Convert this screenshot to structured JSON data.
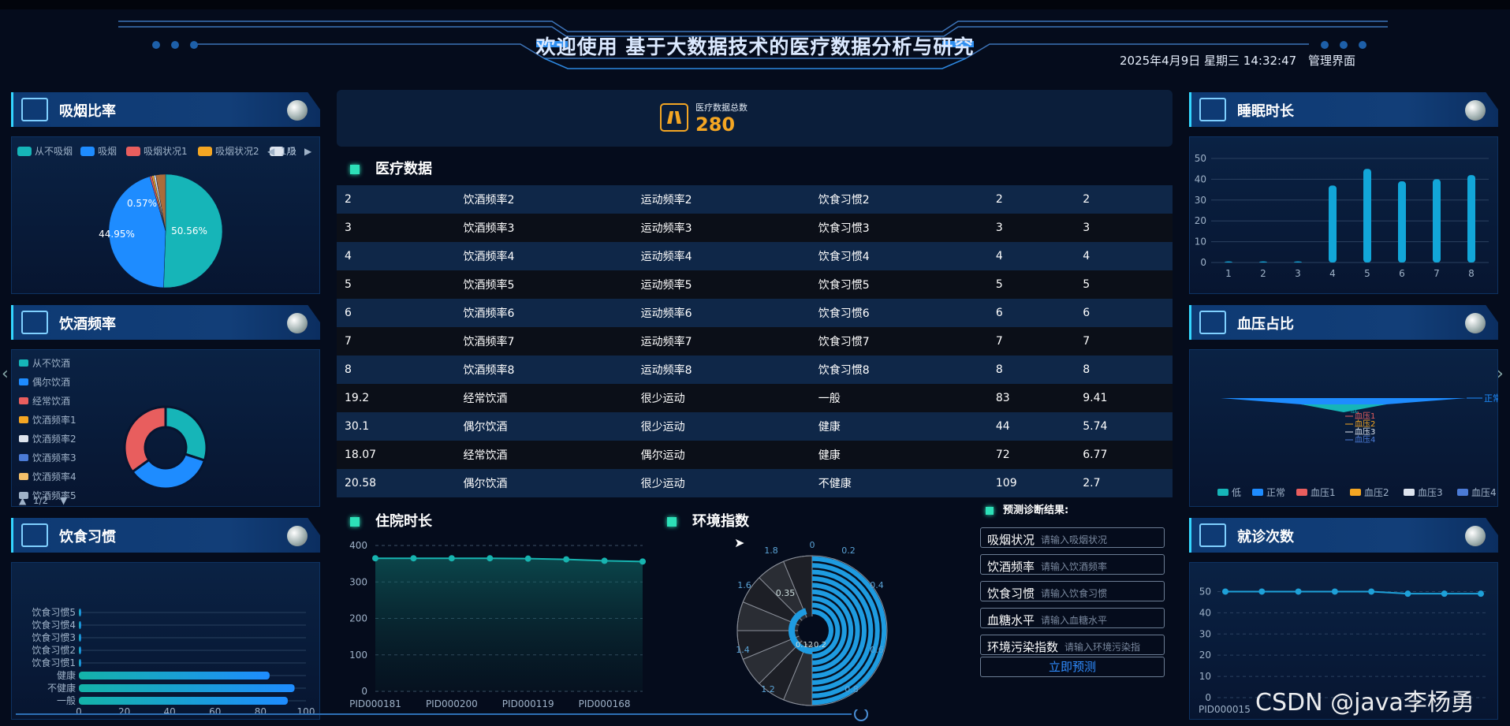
{
  "header": {
    "title": "欢迎使用 基于大数据技术的医疗数据分析与研究",
    "datetime": "2025年4月9日 星期三 14:32:47",
    "admin": "管理界面"
  },
  "panels": {
    "smoke": "吸烟比率",
    "drink": "饮酒频率",
    "diet": "饮食习惯",
    "sleep": "睡眠时长",
    "bp": "血压占比",
    "visits": "就诊次数"
  },
  "total": {
    "label": "医疗数据总数",
    "value": "280"
  },
  "sections": {
    "table": "医疗数据",
    "hospital": "住院时长",
    "env": "环境指数",
    "predict": "预测诊断结果:"
  },
  "table_rows": [
    [
      "2",
      "饮酒频率2",
      "运动频率2",
      "饮食习惯2",
      "2",
      "2"
    ],
    [
      "3",
      "饮酒频率3",
      "运动频率3",
      "饮食习惯3",
      "3",
      "3"
    ],
    [
      "4",
      "饮酒频率4",
      "运动频率4",
      "饮食习惯4",
      "4",
      "4"
    ],
    [
      "5",
      "饮酒频率5",
      "运动频率5",
      "饮食习惯5",
      "5",
      "5"
    ],
    [
      "6",
      "饮酒频率6",
      "运动频率6",
      "饮食习惯6",
      "6",
      "6"
    ],
    [
      "7",
      "饮酒频率7",
      "运动频率7",
      "饮食习惯7",
      "7",
      "7"
    ],
    [
      "8",
      "饮酒频率8",
      "运动频率8",
      "饮食习惯8",
      "8",
      "8"
    ],
    [
      "19.2",
      "经常饮酒",
      "很少运动",
      "一般",
      "83",
      "9.41"
    ],
    [
      "30.1",
      "偶尔饮酒",
      "很少运动",
      "健康",
      "44",
      "5.74"
    ],
    [
      "18.07",
      "经常饮酒",
      "偶尔运动",
      "健康",
      "72",
      "6.77"
    ],
    [
      "20.58",
      "偶尔饮酒",
      "很少运动",
      "不健康",
      "109",
      "2.7"
    ]
  ],
  "predict_form": [
    {
      "label": "吸烟状况",
      "placeholder": "请输入吸烟状况"
    },
    {
      "label": "饮酒频率",
      "placeholder": "请输入饮酒频率"
    },
    {
      "label": "饮食习惯",
      "placeholder": "请输入饮食习惯"
    },
    {
      "label": "血糖水平",
      "placeholder": "请输入血糖水平"
    },
    {
      "label": "环境污染指数",
      "placeholder": "请输入环境污染指"
    }
  ],
  "predict_button": "立即预测",
  "watermark": "CSDN @java李杨勇",
  "colors": {
    "teal": "#16b5b8",
    "blue": "#1e8cff",
    "red": "#e85e5e",
    "orange": "#f4a623",
    "accent": "#34d6ff"
  },
  "chart_data": [
    {
      "type": "pie",
      "panel": "吸烟比率",
      "legend": [
        "从不吸烟",
        "吸烟",
        "吸烟状况1",
        "吸烟状况2",
        "吸"
      ],
      "legend_page": "1/3",
      "values": [
        50.56,
        44.95,
        0.57,
        0.57,
        0.57,
        2.78
      ],
      "data_labels": [
        "50.56%",
        "44.95%",
        "0.57%"
      ],
      "colors": [
        "#16b5b8",
        "#1e8cff",
        "#e85e5e",
        "#f4a623",
        "#dde4ee",
        "#aa6c3a"
      ]
    },
    {
      "type": "pie",
      "panel": "饮酒频率",
      "legend": [
        "从不饮酒",
        "偶尔饮酒",
        "经常饮酒",
        "饮酒频率1",
        "饮酒频率2",
        "饮酒频率3",
        "饮酒频率4",
        "饮酒频率5"
      ],
      "legend_page": "1/2",
      "values": [
        30,
        35,
        35
      ],
      "colors": [
        "#16b5b8",
        "#1e8cff",
        "#e85e5e"
      ]
    },
    {
      "type": "bar",
      "panel": "饮食习惯",
      "categories": [
        "一般",
        "不健康",
        "健康",
        "饮食习惯1",
        "饮食习惯2",
        "饮食习惯3",
        "饮食习惯4",
        "饮食习惯5"
      ],
      "values": [
        92,
        95,
        84,
        1,
        1,
        1,
        1,
        1
      ],
      "xlim": [
        0,
        100
      ],
      "xticks": [
        "0",
        "20",
        "40",
        "60",
        "80",
        "100"
      ]
    },
    {
      "type": "bar",
      "panel": "睡眠时长",
      "categories": [
        "1",
        "2",
        "3",
        "4",
        "5",
        "6",
        "7",
        "8"
      ],
      "values": [
        0.5,
        0.5,
        0.5,
        37,
        45,
        39,
        40,
        42
      ],
      "ylim": [
        0,
        50
      ],
      "yticks": [
        "0",
        "10",
        "20",
        "30",
        "40",
        "50"
      ]
    },
    {
      "type": "funnel",
      "panel": "血压占比",
      "labels": [
        "正常",
        "低",
        "血压1",
        "血压2",
        "血压3",
        "血压4"
      ],
      "legend": [
        "低",
        "正常",
        "血压1",
        "血压2",
        "血压3",
        "血压4"
      ],
      "colors": [
        "#16b5b8",
        "#1e8cff",
        "#e85e5e",
        "#f4a623",
        "#dde4ee",
        "#4b7bd6"
      ]
    },
    {
      "type": "line",
      "panel": "就诊次数",
      "categories": [
        "PID000015",
        "",
        "",
        "",
        "",
        "",
        "",
        ""
      ],
      "values": [
        50,
        50,
        50,
        50,
        50,
        49,
        49,
        49
      ],
      "ylim": [
        0,
        55
      ],
      "yticks": [
        "0",
        "10",
        "20",
        "30",
        "40",
        "50"
      ]
    },
    {
      "type": "area",
      "panel": "住院时长",
      "categories": [
        "PID000181",
        "",
        "PID000200",
        "",
        "PID000119",
        "",
        "PID000168",
        ""
      ],
      "values": [
        365,
        365,
        365,
        365,
        364,
        362,
        358,
        356
      ],
      "ylim": [
        0,
        400
      ],
      "yticks": [
        "0",
        "100",
        "200",
        "300",
        "400"
      ]
    },
    {
      "type": "polar",
      "panel": "环境指数",
      "angle_ticks": [
        "0",
        "0.2",
        "0.4",
        "0.6",
        "0.8",
        "1.2",
        "1.4",
        "1.6",
        "1.8"
      ],
      "radius_ticks": [
        "0.35",
        "0.12",
        "0.2"
      ]
    }
  ]
}
